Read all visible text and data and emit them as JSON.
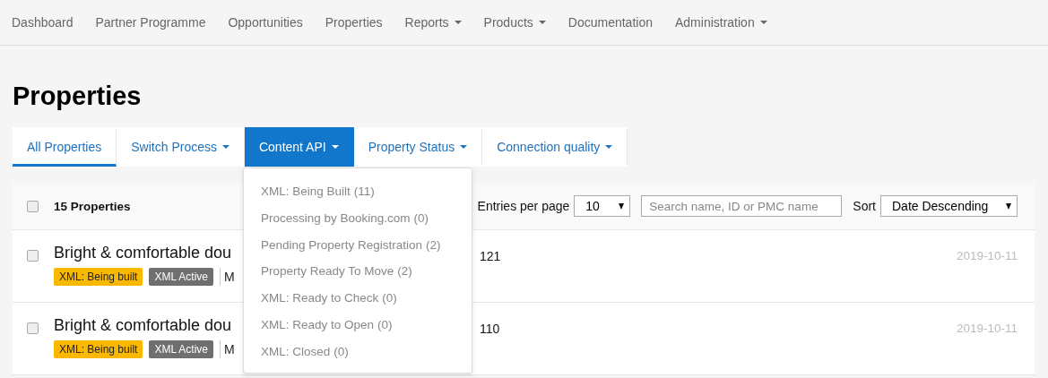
{
  "nav": [
    {
      "label": "Dashboard",
      "has_menu": false
    },
    {
      "label": "Partner Programme",
      "has_menu": false
    },
    {
      "label": "Opportunities",
      "has_menu": false
    },
    {
      "label": "Properties",
      "has_menu": false
    },
    {
      "label": "Reports",
      "has_menu": true
    },
    {
      "label": "Products",
      "has_menu": true
    },
    {
      "label": "Documentation",
      "has_menu": false
    },
    {
      "label": "Administration",
      "has_menu": true
    }
  ],
  "page_title": "Properties",
  "tabs": [
    {
      "label": "All Properties",
      "selected": true,
      "open": false,
      "has_menu": false
    },
    {
      "label": "Switch Process",
      "selected": false,
      "open": false,
      "has_menu": true
    },
    {
      "label": "Content API",
      "selected": false,
      "open": true,
      "has_menu": true
    },
    {
      "label": "Property Status",
      "selected": false,
      "open": false,
      "has_menu": true
    },
    {
      "label": "Connection quality",
      "selected": false,
      "open": false,
      "has_menu": true
    }
  ],
  "dropdown": [
    {
      "label": "XML: Being Built",
      "count": "(11)"
    },
    {
      "label": "Processing by Booking.com",
      "count": "(0)"
    },
    {
      "label": "Pending Property Registration",
      "count": "(2)"
    },
    {
      "label": "Property Ready To Move",
      "count": "(2)"
    },
    {
      "label": "XML: Ready to Check",
      "count": "(0)"
    },
    {
      "label": "XML: Ready to Open",
      "count": "(0)"
    },
    {
      "label": "XML: Closed",
      "count": "(0)"
    }
  ],
  "list_header": {
    "checked": false,
    "count": "15 Properties",
    "per_page_label": "Entries per page",
    "per_page": "10",
    "search_placeholder": "Search name, ID or PMC name",
    "sort_label": "Sort",
    "sort": "Date Descending"
  },
  "rows": [
    {
      "checked": false,
      "title": "Bright & comfortable dou",
      "column_2": "121",
      "date": "2019-10-11",
      "tags": [
        {
          "label": "XML: Being built",
          "color": "#fbb800"
        },
        {
          "label": "XML Active",
          "color": "#6f6f6f"
        }
      ],
      "extra": "M"
    },
    {
      "checked": false,
      "title": "Bright & comfortable dou",
      "column_2": "110",
      "date": "2019-10-11",
      "tags": [
        {
          "label": "XML: Being built",
          "color": "#fbb800"
        },
        {
          "label": "XML Active",
          "color": "#6f6f6f"
        }
      ],
      "extra": "M"
    }
  ]
}
